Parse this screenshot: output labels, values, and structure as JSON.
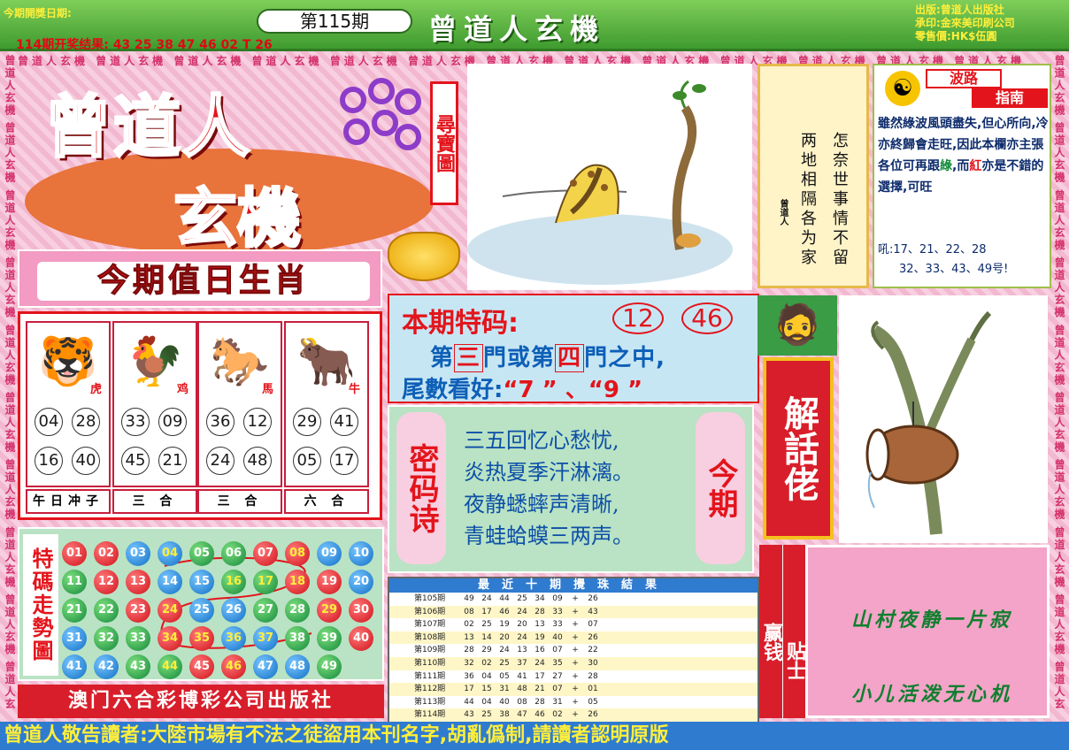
{
  "header": {
    "date_label": "今期開獎日期:",
    "prev_results": "114期开奖结果: 43 25 38 47 46 02 T 26",
    "issue": "第115期",
    "title": "曾道人玄機",
    "publisher_lines": [
      "出版:曾道人出版社",
      "承印:金來美印刷公司",
      "零售價:HK$伍圓"
    ]
  },
  "ribbon_text": "曾道人玄機 曾道人玄機 曾道人玄機 曾道人玄機 曾道人玄機 曾道人玄機 曾道人玄機 曾道人玄機 曾道人玄機 曾道人玄機 曾道人玄機 曾道人玄機 曾道人玄機",
  "logo": {
    "line1": "曾道人",
    "line2": "玄機",
    "badge": "尋寶圖"
  },
  "zodiac": {
    "title": "今期值日生肖",
    "animals": [
      {
        "icon": "tiger-icon",
        "glyph": "🐯",
        "name": "虎",
        "numbers": [
          "04",
          "28",
          "16",
          "40"
        ],
        "label": "午日冲子"
      },
      {
        "icon": "rooster-icon",
        "glyph": "🐓",
        "name": "鸡",
        "numbers": [
          "33",
          "09",
          "45",
          "21"
        ],
        "label": "三 合"
      },
      {
        "icon": "horse-icon",
        "glyph": "🐎",
        "name": "馬",
        "numbers": [
          "36",
          "12",
          "24",
          "48"
        ],
        "label": "三 合"
      },
      {
        "icon": "ox-icon",
        "glyph": "🐂",
        "name": "牛",
        "numbers": [
          "29",
          "41",
          "05",
          "17"
        ],
        "label": "六 合"
      }
    ]
  },
  "trend": {
    "label": "特碼走勢圖",
    "rows": [
      [
        "01",
        "02",
        "03",
        "04",
        "05",
        "06",
        "07",
        "08",
        "09",
        "10"
      ],
      [
        "11",
        "12",
        "13",
        "14",
        "15",
        "16",
        "17",
        "18",
        "19",
        "20"
      ],
      [
        "21",
        "22",
        "23",
        "24",
        "25",
        "26",
        "27",
        "28",
        "29",
        "30"
      ],
      [
        "31",
        "32",
        "33",
        "34",
        "35",
        "36",
        "37",
        "38",
        "39",
        "40"
      ],
      [
        "41",
        "42",
        "43",
        "44",
        "45",
        "46",
        "47",
        "48",
        "49"
      ]
    ],
    "colors": {
      "01": "red",
      "02": "red",
      "03": "blue",
      "04": "blue",
      "05": "green",
      "06": "green",
      "07": "red",
      "08": "red",
      "09": "blue",
      "10": "blue",
      "11": "green",
      "12": "red",
      "13": "red",
      "14": "blue",
      "15": "blue",
      "16": "green",
      "17": "green",
      "18": "red",
      "19": "red",
      "20": "blue",
      "21": "green",
      "22": "green",
      "23": "red",
      "24": "red",
      "25": "blue",
      "26": "blue",
      "27": "green",
      "28": "green",
      "29": "red",
      "30": "red",
      "31": "blue",
      "32": "green",
      "33": "green",
      "34": "red",
      "35": "red",
      "36": "blue",
      "37": "blue",
      "38": "green",
      "39": "green",
      "40": "red",
      "41": "blue",
      "42": "blue",
      "43": "green",
      "44": "green",
      "45": "red",
      "46": "red",
      "47": "blue",
      "48": "blue",
      "49": "green"
    },
    "highlighted": [
      "04",
      "08",
      "16",
      "17",
      "18",
      "24",
      "29",
      "34",
      "35",
      "36",
      "37",
      "44",
      "46"
    ],
    "publisher": "澳门六合彩博彩公司出版社"
  },
  "special": {
    "title": "本期特码:",
    "numbers": [
      "12",
      "46"
    ],
    "line1_a": "第",
    "line1_b": "三",
    "line1_c": "門或第",
    "line1_d": "四",
    "line1_e": "門之中,",
    "line2_a": "尾數看好:",
    "line2_b": "“7 ” 、“9 ”"
  },
  "poem": {
    "left_tag": "密码诗",
    "right_tag": "今期",
    "lines": [
      "三五回忆心愁忧,",
      "炎热夏季汗淋漓。",
      "夜静蟋蟀声清晰,",
      "青蛙蛤蟆三两声。"
    ]
  },
  "results": {
    "title": "最近十期攪珠結果",
    "rows": [
      {
        "label": "第105期",
        "nums": [
          "49",
          "24",
          "44",
          "25",
          "34",
          "09",
          "+",
          "26"
        ]
      },
      {
        "label": "第106期",
        "nums": [
          "08",
          "17",
          "46",
          "24",
          "28",
          "33",
          "+",
          "43"
        ]
      },
      {
        "label": "第107期",
        "nums": [
          "02",
          "25",
          "19",
          "20",
          "13",
          "33",
          "+",
          "07"
        ]
      },
      {
        "label": "第108期",
        "nums": [
          "13",
          "14",
          "20",
          "24",
          "19",
          "40",
          "+",
          "26"
        ]
      },
      {
        "label": "第109期",
        "nums": [
          "28",
          "29",
          "24",
          "13",
          "16",
          "07",
          "+",
          "22"
        ]
      },
      {
        "label": "第110期",
        "nums": [
          "32",
          "02",
          "25",
          "37",
          "24",
          "35",
          "+",
          "30"
        ]
      },
      {
        "label": "第111期",
        "nums": [
          "36",
          "04",
          "05",
          "41",
          "17",
          "27",
          "+",
          "28"
        ]
      },
      {
        "label": "第112期",
        "nums": [
          "17",
          "15",
          "31",
          "48",
          "21",
          "07",
          "+",
          "01"
        ]
      },
      {
        "label": "第113期",
        "nums": [
          "44",
          "04",
          "40",
          "08",
          "28",
          "31",
          "+",
          "05"
        ]
      },
      {
        "label": "第114期",
        "nums": [
          "43",
          "25",
          "38",
          "47",
          "46",
          "02",
          "+",
          "26"
        ]
      }
    ]
  },
  "verse": {
    "col1": "怎奈世事情不留",
    "col2": "两地相隔各为家",
    "seal": "曾道人"
  },
  "tips": {
    "head1": "波路",
    "head2": "指南",
    "body_a": "雖然綠波風頭盡失,但心所向,冷亦終歸會走旺,因此本欄亦主張各位可再跟",
    "body_g": "綠",
    "body_b": ",而",
    "body_r": "紅",
    "body_c": "亦是不錯的選擇,可旺",
    "nums1": "吼:17、21、22、28",
    "nums2": "32、33、43、49号!"
  },
  "jiehua": "解話佬",
  "winning": {
    "label1": "赢钱",
    "label2": "贴士",
    "line1": "山村夜静一片寂",
    "line2": "小儿活泼无心机"
  },
  "footer": "曾道人敬告讀者:大陸市場有不法之徒盜用本刊名字,胡亂僞制,請讀者認明原版"
}
